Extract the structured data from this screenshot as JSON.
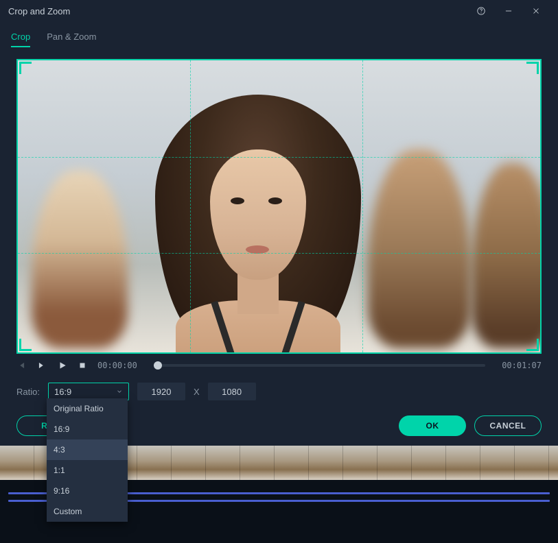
{
  "window": {
    "title": "Crop and Zoom"
  },
  "tabs": {
    "crop": "Crop",
    "pan_zoom": "Pan & Zoom"
  },
  "transport": {
    "current": "00:00:00",
    "total": "00:01:07"
  },
  "ratio": {
    "label": "Ratio:",
    "selected": "16:9",
    "width": "1920",
    "sep": "X",
    "height": "1080",
    "options": {
      "original": "Original Ratio",
      "r169": "16:9",
      "r43": "4:3",
      "r11": "1:1",
      "r916": "9:16",
      "custom": "Custom"
    }
  },
  "buttons": {
    "reset": "RE",
    "ok": "OK",
    "cancel": "CANCEL"
  }
}
